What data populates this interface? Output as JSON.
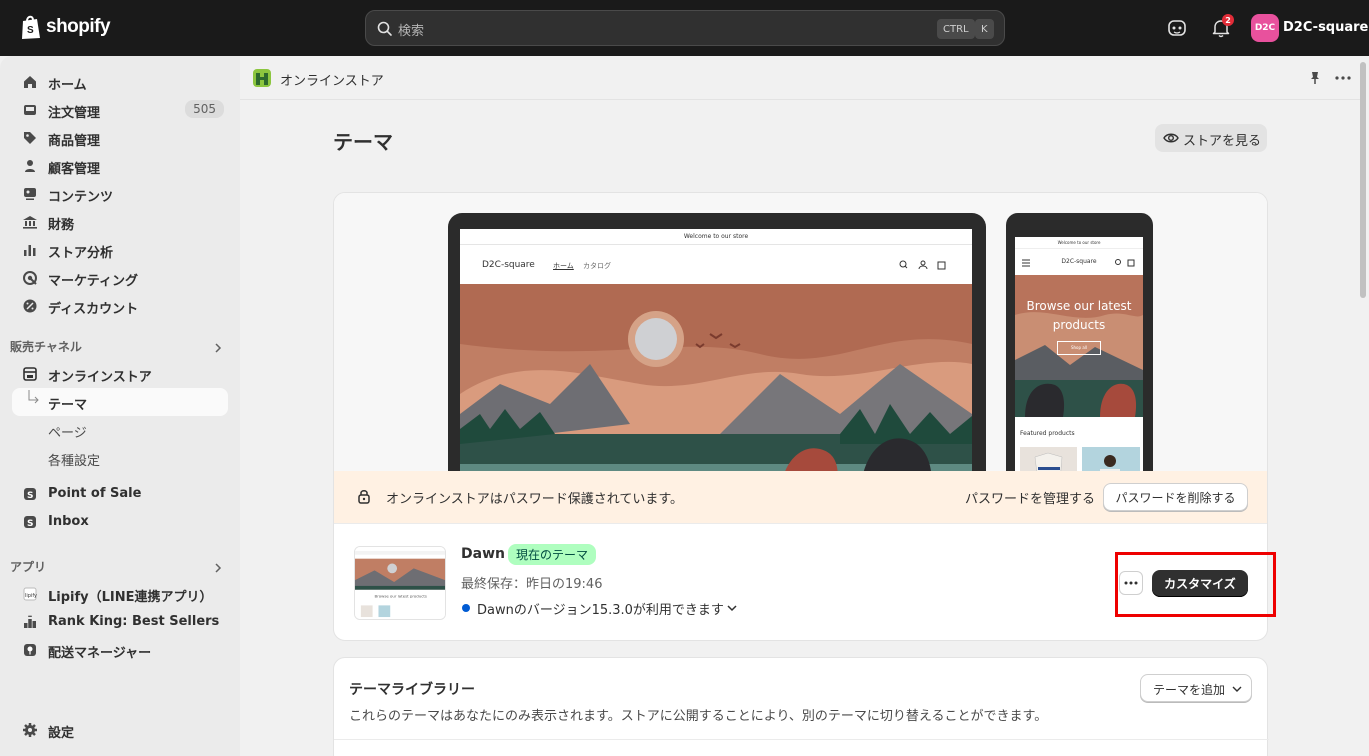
{
  "topbar": {
    "logo_text": "shopify",
    "search_placeholder": "検索",
    "shortcut_ctrl": "CTRL",
    "shortcut_key": "K",
    "notification_count": "2",
    "avatar_initials": "D2C",
    "store_name": "D2C-square"
  },
  "sidebar": {
    "main_items": [
      {
        "label": "ホーム",
        "icon": "home-icon"
      },
      {
        "label": "注文管理",
        "icon": "inbox-icon",
        "count": "505"
      },
      {
        "label": "商品管理",
        "icon": "tag-icon"
      },
      {
        "label": "顧客管理",
        "icon": "person-icon"
      },
      {
        "label": "コンテンツ",
        "icon": "content-icon"
      },
      {
        "label": "財務",
        "icon": "bank-icon"
      },
      {
        "label": "ストア分析",
        "icon": "chart-icon"
      },
      {
        "label": "マーケティング",
        "icon": "target-icon"
      },
      {
        "label": "ディスカウント",
        "icon": "discount-icon"
      }
    ],
    "sales_channels_title": "販売チャネル",
    "online_store": "オンラインストア",
    "sub_items": [
      "テーマ",
      "ページ",
      "各種設定"
    ],
    "pos": "Point of Sale",
    "inbox": "Inbox",
    "apps_title": "アプリ",
    "apps": [
      "Lipify（LINE連携アプリ）",
      "Rank King: Best Sellers",
      "配送マネージャー"
    ],
    "settings": "設定"
  },
  "breadcrumb": {
    "label": "オンラインストア"
  },
  "page": {
    "title": "テーマ",
    "view_store": "ストアを見る"
  },
  "preview": {
    "tablet_announcement": "Welcome to our store",
    "tablet_brand": "D2C-square",
    "tablet_nav_home": "ホーム",
    "tablet_nav_catalog": "カタログ",
    "phone_announcement": "Welcome to our store",
    "phone_brand": "D2C-square",
    "phone_hero_text": "Browse our latest products",
    "phone_shop_all": "Shop all",
    "phone_featured": "Featured products"
  },
  "password_banner": {
    "message": "オンラインストアはパスワード保護されています。",
    "manage": "パスワードを管理する",
    "remove": "パスワードを削除する"
  },
  "current_theme": {
    "name": "Dawn",
    "badge": "現在のテーマ",
    "last_saved": "最終保存：昨日の19:46",
    "version_notice": "Dawnのバージョン15.3.0が利用できます",
    "customize": "カスタマイズ"
  },
  "library": {
    "title": "テーマライブラリー",
    "description": "これらのテーマはあなたにのみ表示されます。ストアに公開することにより、別のテーマに切り替えることができます。",
    "add_theme": "テーマを追加"
  },
  "colors": {
    "topbar": "#1a1a1a",
    "current_badge_bg": "#affebf",
    "password_banner_bg": "#fff1e3",
    "primary_button": "#303030",
    "highlight": "#ee0000"
  }
}
